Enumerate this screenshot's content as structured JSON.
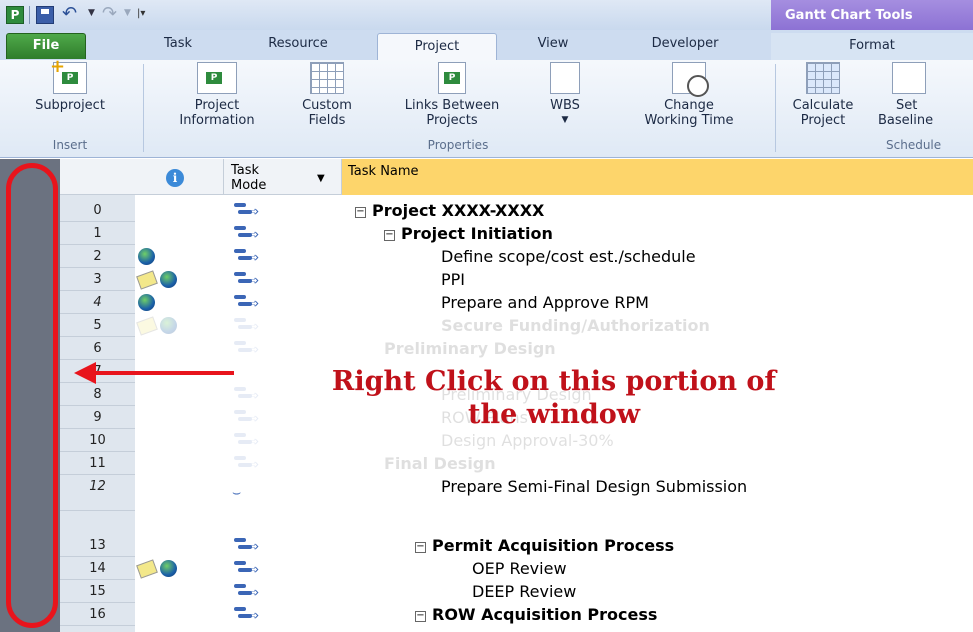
{
  "window": {
    "app_icon_letter": "P",
    "contextual_tab_group": "Gantt Chart Tools"
  },
  "tabs": {
    "file": "File",
    "task": "Task",
    "resource": "Resource",
    "project": "Project",
    "view": "View",
    "developer": "Developer",
    "format": "Format"
  },
  "ribbon": {
    "subproject": "Subproject",
    "project_information": [
      "Project",
      "Information"
    ],
    "custom_fields": [
      "Custom",
      "Fields"
    ],
    "links_between_projects": [
      "Links Between",
      "Projects"
    ],
    "wbs": "WBS",
    "change_working_time": [
      "Change",
      "Working Time"
    ],
    "calculate_project": [
      "Calculate",
      "Project"
    ],
    "set_baseline": [
      "Set",
      "Baseline"
    ],
    "groups": {
      "insert": "Insert",
      "properties": "Properties",
      "schedule": "Schedule"
    }
  },
  "grid": {
    "headers": {
      "info": "i",
      "task_mode": [
        "Task",
        "Mode"
      ],
      "task_name": "Task Name"
    },
    "rows": [
      {
        "num": "0",
        "name": "Project XXXX-XXXX"
      },
      {
        "num": "1",
        "name": "Project Initiation"
      },
      {
        "num": "2",
        "name": "Define scope/cost est./schedule"
      },
      {
        "num": "3",
        "name": "PPI"
      },
      {
        "num": "4",
        "name": "Prepare and Approve RPM"
      },
      {
        "num": "5",
        "name": "Secure Funding/Authorization"
      },
      {
        "num": "6",
        "name": "Preliminary Design"
      },
      {
        "num": "7",
        "name": ""
      },
      {
        "num": "8",
        "name": "Preliminary Design"
      },
      {
        "num": "9",
        "name": "ROW Plans"
      },
      {
        "num": "10",
        "name": "Design Approval-30%"
      },
      {
        "num": "11",
        "name": "Final Design"
      },
      {
        "num": "12",
        "name": "Prepare Semi-Final Design Submission"
      },
      {
        "num": "13",
        "name": "Permit Acquisition Process"
      },
      {
        "num": "14",
        "name": "OEP Review"
      },
      {
        "num": "15",
        "name": "DEEP Review"
      },
      {
        "num": "16",
        "name": "ROW Acquisition Process"
      }
    ]
  },
  "annotation": {
    "callout_line1": "Right Click on this portion of",
    "callout_line2": "the window",
    "color": "#e8141c"
  }
}
